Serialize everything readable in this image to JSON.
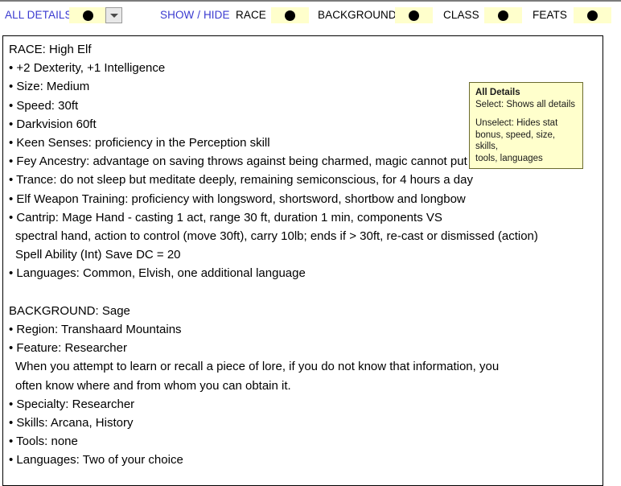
{
  "toolbar": {
    "all_details_label": "ALL DETAILS",
    "all_details_toggle_icon": "filled-circle-icon",
    "all_details_dropdown_icon": "chevron-down-icon",
    "show_hide_label": "SHOW / HIDE",
    "sections": [
      {
        "label": "RACE",
        "toggle_icon": "filled-circle-icon",
        "state": "on"
      },
      {
        "label": "BACKGROUND",
        "toggle_icon": "filled-circle-icon",
        "state": "on"
      },
      {
        "label": "CLASS",
        "toggle_icon": "filled-circle-icon",
        "state": "on"
      },
      {
        "label": "FEATS",
        "toggle_icon": "filled-circle-icon",
        "state": "on"
      }
    ]
  },
  "tooltip": {
    "title": "All Details",
    "select_line": "Select: Shows all details",
    "unselect_line_1": "Unselect: Hides stat",
    "unselect_line_2": "bonus, speed, size, skills,",
    "unselect_line_3": "tools, languages"
  },
  "details": {
    "lines": [
      "RACE: High Elf",
      "• +2 Dexterity, +1 Intelligence",
      "• Size: Medium",
      "• Speed: 30ft",
      "• Darkvision 60ft",
      "• Keen Senses: proficiency in the Perception skill",
      "• Fey Ancestry: advantage on saving throws against being charmed, magic cannot put you to sleep",
      "• Trance: do not sleep but meditate deeply, remaining semiconscious, for 4 hours a day",
      "• Elf Weapon Training: proficiency with longsword, shortsword, shortbow and longbow",
      "• Cantrip: Mage Hand - casting 1 act, range 30 ft, duration 1 min, components VS",
      "spectral hand, action to control (move 30ft), carry 10lb; ends if > 30ft, re-cast or dismissed (action)",
      "Spell Ability (Int) Save DC = 20",
      "• Languages: Common, Elvish, one additional language",
      "",
      "BACKGROUND: Sage",
      "• Region: Transhaard Mountains",
      "• Feature: Researcher",
      "When you attempt to learn or recall a piece of lore, if you do not know that information, you",
      "often know where and from whom you can obtain it.",
      "• Specialty: Researcher",
      "• Skills: Arcana, History",
      "• Tools: none",
      "• Languages: Two of your choice"
    ],
    "indented_line_indices": [
      10,
      11,
      17,
      18
    ]
  },
  "colors": {
    "toggle_background": "#ffffcc",
    "toggle_dot": "#000000",
    "link_text": "#3a3ad0",
    "tooltip_background": "#ffffcc",
    "tooltip_border": "#6b6b2e",
    "panel_border": "#000000",
    "top_rule": "#7b7b7b"
  }
}
